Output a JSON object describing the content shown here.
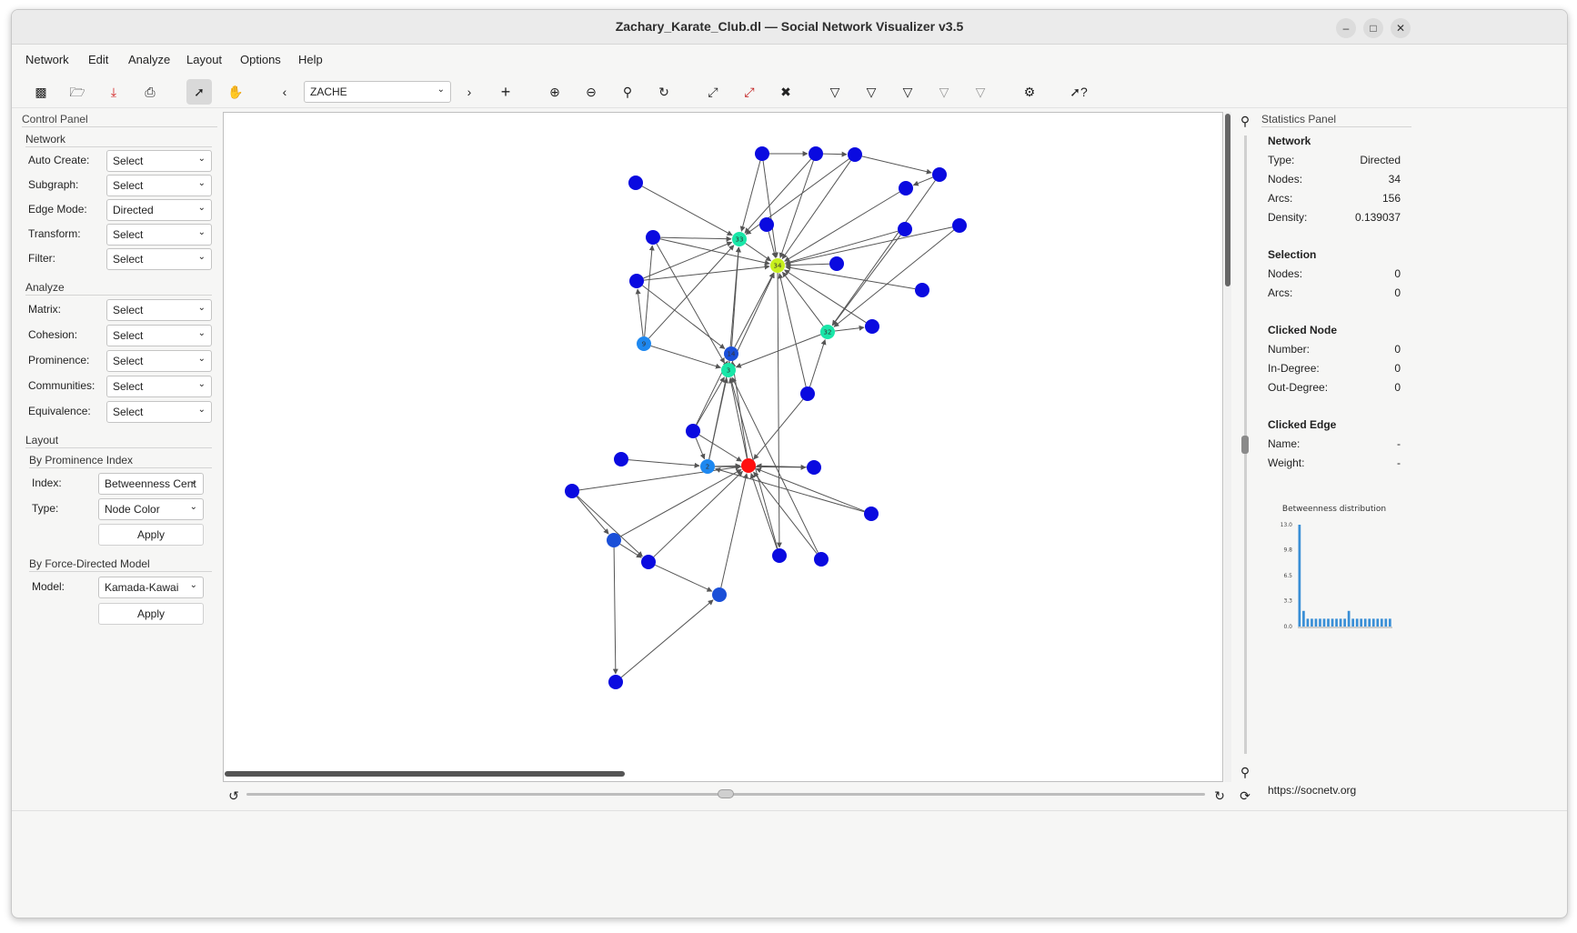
{
  "window": {
    "title": "Zachary_Karate_Club.dl — Social Network Visualizer v3.5",
    "controls": [
      "–",
      "□",
      "✕"
    ]
  },
  "menu": [
    "Network",
    "Edit",
    "Analyze",
    "Layout",
    "Options",
    "Help"
  ],
  "toolbar": {
    "node_combo_value": "ZACHE",
    "icons": [
      "new-network-icon",
      "open-folder-icon",
      "save-icon",
      "print-icon",
      "select-pointer-icon",
      "hand-pan-icon",
      "prev-icon",
      "next-icon",
      "add-node-icon",
      "zoom-in-icon",
      "zoom-out-icon",
      "find-icon",
      "rotate-icon",
      "edge-icon",
      "edge-remove-icon",
      "tools-icon",
      "filter-1-icon",
      "filter-2-icon",
      "filter-3-icon",
      "filter-4-icon",
      "filter-5-icon",
      "settings-icon",
      "help-icon"
    ]
  },
  "control_panel": {
    "title": "Control Panel",
    "network": {
      "heading": "Network",
      "rows": [
        {
          "label": "Auto Create:",
          "value": "Select"
        },
        {
          "label": "Subgraph:",
          "value": "Select"
        },
        {
          "label": "Edge Mode:",
          "value": "Directed"
        },
        {
          "label": "Transform:",
          "value": "Select"
        },
        {
          "label": "Filter:",
          "value": "Select"
        }
      ]
    },
    "analyze": {
      "heading": "Analyze",
      "rows": [
        {
          "label": "Matrix:",
          "value": "Select"
        },
        {
          "label": "Cohesion:",
          "value": "Select"
        },
        {
          "label": "Prominence:",
          "value": "Select"
        },
        {
          "label": "Communities:",
          "value": "Select"
        },
        {
          "label": "Equivalence:",
          "value": "Select"
        }
      ]
    },
    "layout": {
      "heading": "Layout",
      "prominence": {
        "heading": "By Prominence Index",
        "index_label": "Index:",
        "index_value": "Betweenness Cent",
        "type_label": "Type:",
        "type_value": "Node Color",
        "apply": "Apply"
      },
      "force": {
        "heading": "By Force-Directed Model",
        "model_label": "Model:",
        "model_value": "Kamada-Kawai",
        "apply": "Apply"
      }
    }
  },
  "graph": {
    "node_labels": {
      "n33": "33",
      "n34": "34",
      "n32": "32",
      "n3": "3",
      "n14": "14",
      "n9": "9",
      "n2": "2"
    },
    "colors": {
      "blue": "#0a0ae0",
      "mid_blue": "#1a4fd8",
      "light_blue": "#1e88f0",
      "teal": "#19e6a8",
      "yellow": "#c8f01e",
      "red": "#ff1010",
      "edge": "#555555"
    }
  },
  "statistics": {
    "title": "Statistics Panel",
    "network": {
      "heading": "Network",
      "rows": [
        {
          "label": "Type:",
          "value": "Directed"
        },
        {
          "label": "Nodes:",
          "value": "34"
        },
        {
          "label": "Arcs:",
          "value": "156"
        },
        {
          "label": "Density:",
          "value": "0.139037"
        }
      ]
    },
    "selection": {
      "heading": "Selection",
      "rows": [
        {
          "label": "Nodes:",
          "value": "0"
        },
        {
          "label": "Arcs:",
          "value": "0"
        }
      ]
    },
    "clicked_node": {
      "heading": "Clicked Node",
      "rows": [
        {
          "label": "Number:",
          "value": "0"
        },
        {
          "label": "In-Degree:",
          "value": "0"
        },
        {
          "label": "Out-Degree:",
          "value": "0"
        }
      ]
    },
    "clicked_edge": {
      "heading": "Clicked Edge",
      "rows": [
        {
          "label": "Name:",
          "value": "-"
        },
        {
          "label": "Weight:",
          "value": "-"
        }
      ]
    },
    "link": "https://socnetv.org"
  },
  "chart_data": {
    "type": "bar",
    "title": "Betweenness distribution",
    "y_ticks": [
      "13.0",
      "9.8",
      "6.5",
      "3.3",
      "0.0"
    ],
    "ylim": [
      0,
      13
    ],
    "values": [
      13,
      2,
      1,
      1,
      1,
      1,
      1,
      1,
      1,
      1,
      1,
      1,
      2,
      1,
      1,
      1,
      1,
      1,
      1,
      1,
      1,
      1,
      1
    ],
    "color": "#3a8fd6"
  }
}
